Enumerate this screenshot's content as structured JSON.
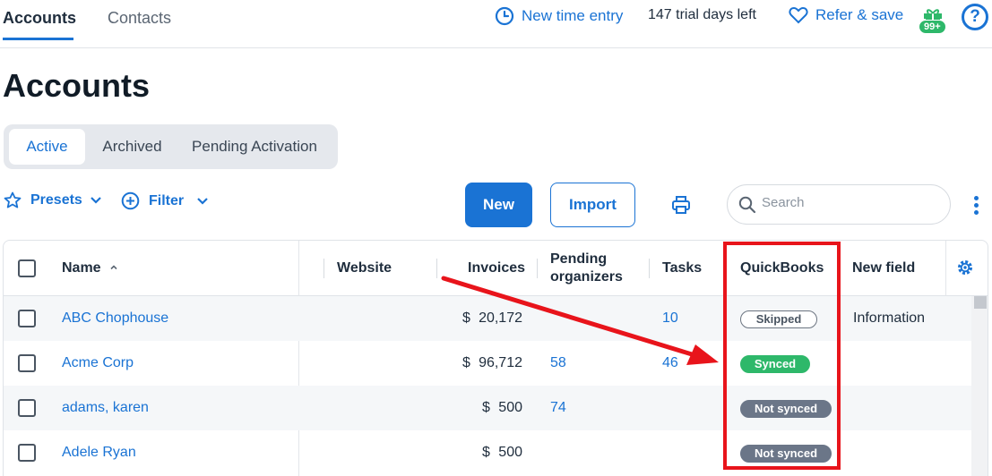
{
  "topnav": {
    "tabs": [
      {
        "label": "Accounts",
        "active": true
      },
      {
        "label": "Contacts",
        "active": false
      }
    ],
    "new_time_entry": "New time entry",
    "trial": "147 trial days left",
    "refer": "Refer & save",
    "gift_badge": "99+",
    "help": "?"
  },
  "page": {
    "title": "Accounts"
  },
  "status_tabs": [
    {
      "label": "Active",
      "active": true
    },
    {
      "label": "Archived",
      "active": false
    },
    {
      "label": "Pending Activation",
      "active": false
    }
  ],
  "toolbar": {
    "presets": "Presets",
    "filter": "Filter",
    "new": "New",
    "import": "Import",
    "search_placeholder": "Search"
  },
  "table": {
    "columns": {
      "name": "Name",
      "website": "Website",
      "invoices": "Invoices",
      "pending_line1": "Pending",
      "pending_line2": "organizers",
      "tasks": "Tasks",
      "quickbooks": "QuickBooks",
      "new_field": "New field"
    },
    "rows": [
      {
        "name": "ABC Chophouse",
        "currency": "$",
        "invoices": "20,172",
        "pending": "",
        "tasks": "10",
        "quickbooks": "Skipped",
        "qb_status": "skipped",
        "new_field": "Information"
      },
      {
        "name": "Acme Corp",
        "currency": "$",
        "invoices": "96,712",
        "pending": "58",
        "tasks": "46",
        "quickbooks": "Synced",
        "qb_status": "synced",
        "new_field": ""
      },
      {
        "name": "adams, karen",
        "currency": "$",
        "invoices": "500",
        "pending": "74",
        "tasks": "",
        "quickbooks": "Not synced",
        "qb_status": "notsynced",
        "new_field": ""
      },
      {
        "name": "Adele Ryan",
        "currency": "$",
        "invoices": "500",
        "pending": "",
        "tasks": "",
        "quickbooks": "Not synced",
        "qb_status": "notsynced",
        "new_field": ""
      }
    ]
  },
  "colors": {
    "accent": "#1a73d4",
    "synced": "#2eb86a",
    "not_synced": "#6b7688",
    "annotation": "#e8141b"
  }
}
